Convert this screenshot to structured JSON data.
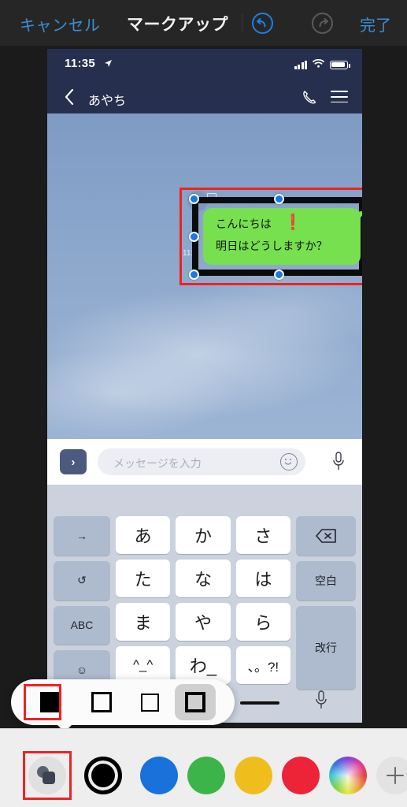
{
  "markup_toolbar": {
    "cancel_label": "キャンセル",
    "title": "マークアップ",
    "done_label": "完了",
    "undo_icon": "undo-arrow-icon",
    "redo_icon": "redo-arrow-icon",
    "undo_enabled_color": "#1f7fe0",
    "redo_disabled_color": "#5b5b5b"
  },
  "phone": {
    "status_bar": {
      "time": "11:35",
      "location_icon": "location-arrow-icon",
      "signal_icon": "cellular-signal-icon",
      "wifi_icon": "wifi-icon",
      "battery_icon": "battery-icon"
    },
    "nav_bar": {
      "back_icon": "chevron-left-icon",
      "contact_name": "あやち",
      "call_icon": "phone-handset-icon",
      "menu_icon": "hamburger-menu-icon",
      "bg_color": "#262f4e"
    },
    "chat": {
      "message_time": "11:",
      "bubble": {
        "line1": "こんにちは",
        "emphasis": "❗",
        "line2": "明日はどうしますか？",
        "bubble_color": "#77e04f"
      },
      "annotation_shape": "black-rectangle",
      "selection_handles": 6
    },
    "input_bar": {
      "send_icon": "chevron-right-send-icon",
      "placeholder": "メッセージを入力",
      "emoji_icon": "smiley-face-icon",
      "mic_icon": "microphone-icon"
    },
    "keyboard": {
      "rows": [
        {
          "left": "→",
          "keys": [
            "あ",
            "か",
            "さ"
          ],
          "right": "⌫"
        },
        {
          "left": "↺",
          "keys": [
            "た",
            "な",
            "は"
          ],
          "right": "空白"
        },
        {
          "left": "ABC",
          "keys": [
            "ま",
            "や",
            "ら"
          ],
          "right": "改行"
        },
        {
          "left": "☺",
          "keys": [
            "^_^",
            "わ_",
            "、。?!"
          ],
          "right": ""
        }
      ],
      "globe_icon": "globe-language-icon",
      "mic_icon": "microphone-icon",
      "bg_color": "#cbd2dd"
    }
  },
  "shape_popover": {
    "options": [
      {
        "name": "filled-square",
        "label": "塗りつぶし"
      },
      {
        "name": "outline-square-thick",
        "label": "枠線太"
      },
      {
        "name": "outline-square-thin",
        "label": "枠線細"
      },
      {
        "name": "double-square",
        "label": "二重枠"
      }
    ],
    "selected_index": 3,
    "highlighted_index": 0,
    "line_weight_indicator": "thick-line"
  },
  "color_toolbar": {
    "style_button": {
      "name": "shape-style-button",
      "highlighted": true
    },
    "swatches": [
      {
        "name": "black",
        "hex": "#000000",
        "selected": true
      },
      {
        "name": "blue",
        "hex": "#1971dc",
        "selected": false
      },
      {
        "name": "green",
        "hex": "#3cb44a",
        "selected": false
      },
      {
        "name": "yellow",
        "hex": "#efbe1c",
        "selected": false
      },
      {
        "name": "red",
        "hex": "#ed2338",
        "selected": false
      },
      {
        "name": "color-wheel",
        "hex": "rainbow",
        "selected": false
      }
    ],
    "add_label": "+"
  }
}
